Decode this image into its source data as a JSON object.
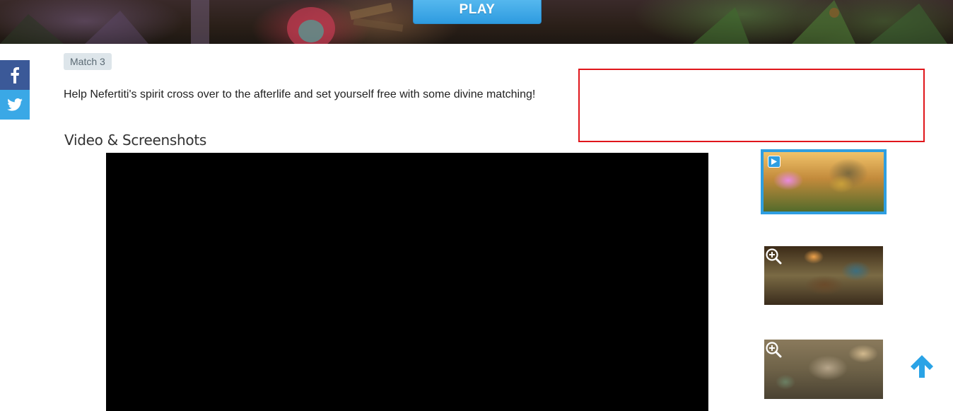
{
  "hero": {
    "play_label": "PLAY"
  },
  "share": {
    "facebook_icon": "facebook-icon",
    "twitter_icon": "twitter-icon",
    "facebook_color": "#3b5998",
    "twitter_color": "#3aa8e6"
  },
  "game": {
    "tag": "Match 3",
    "description": "Help Nefertiti's spirit cross over to the afterlife and set yourself free with some divine matching!"
  },
  "media": {
    "section_title": "Video & Screenshots",
    "thumbnails": [
      {
        "kind": "video",
        "icon": "play-icon"
      },
      {
        "kind": "screenshot",
        "icon": "zoom-in-icon"
      },
      {
        "kind": "screenshot",
        "icon": "zoom-in-icon"
      }
    ]
  },
  "colors": {
    "accent": "#2f9ee0",
    "ad_border": "#e0161b"
  },
  "back_to_top_icon": "arrow-up-icon"
}
